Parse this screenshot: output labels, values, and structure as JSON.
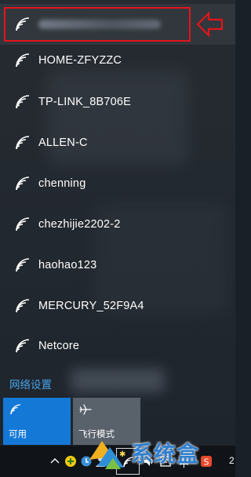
{
  "networks": {
    "connected": {
      "name_visible": false
    },
    "items": [
      {
        "name": "HOME-ZFYZZC"
      },
      {
        "name": "TP-LINK_8B706E"
      },
      {
        "name": "ALLEN-C"
      },
      {
        "name": "chenning"
      },
      {
        "name": "chezhijie2202-2"
      },
      {
        "name": "haohao123"
      },
      {
        "name": "MERCURY_52F9A4"
      },
      {
        "name": "Netcore"
      }
    ]
  },
  "settings": {
    "label": "网络设置"
  },
  "tiles": {
    "wifi": {
      "label": "可用",
      "icon": "wifi-icon"
    },
    "airplane": {
      "label": "飞行模式",
      "icon": "airplane-icon"
    }
  },
  "taskbar": {
    "ime_label": "中",
    "clock_partial": "2"
  },
  "watermark": {
    "text": "系统盒"
  },
  "colors": {
    "accent": "#1479d6",
    "link": "#4aa3e8",
    "highlight": "#e3141b",
    "tile_off": "#59616b"
  }
}
